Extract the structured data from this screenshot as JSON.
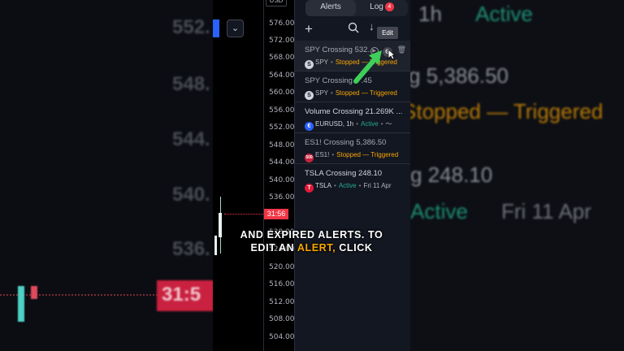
{
  "background_left": {
    "numbers": [
      "552.",
      "548.",
      "544.",
      "540.",
      "536."
    ],
    "price_box": "31:5"
  },
  "background_right": {
    "line1": "1h",
    "line1_status": "Active",
    "line2": "g 5,386.50",
    "line3": "Stopped — Triggered",
    "line4": "g 248.10",
    "line5_status": "Active",
    "line5_date": "Fri 11 Apr"
  },
  "axis": {
    "currency": "USD",
    "ticks": [
      "576.00",
      "572.00",
      "568.00",
      "564.00",
      "560.00",
      "556.00",
      "552.00",
      "548.00",
      "544.00",
      "540.00",
      "536.00",
      "532.00",
      "528.00",
      "524.00",
      "520.00",
      "516.00",
      "512.00",
      "508.00",
      "504.00"
    ],
    "price_tag": "31:56"
  },
  "panel": {
    "tabs": {
      "alerts": "Alerts",
      "log": "Log",
      "log_count": "4"
    },
    "tooltip": "Edit",
    "alerts": [
      {
        "title": "SPY Crossing 532.",
        "symbol": "SPY",
        "symbol_icon": "S",
        "status": "Stopped — Triggered",
        "status_kind": "stopped",
        "selected": true
      },
      {
        "title": "SPY Crossing 5 .45",
        "symbol": "SPY",
        "symbol_icon": "S",
        "status": "Stopped — Triggered",
        "status_kind": "stopped",
        "selected": false
      },
      {
        "title": "Volume Crossing 21.269K ...",
        "symbol": "EURUSD, 1h",
        "symbol_icon": "€",
        "status": "Active",
        "status_kind": "active",
        "selected": false
      },
      {
        "title": "ES1! Crossing 5,386.50",
        "symbol": "ES1!",
        "symbol_icon": "500",
        "status": "Stopped — Triggered",
        "status_kind": "stopped",
        "selected": false
      },
      {
        "title": "TSLA Crossing 248.10",
        "symbol": "TSLA",
        "symbol_icon": "T",
        "status": "Active",
        "status_kind": "active",
        "date": "Fri 11 Apr",
        "selected": false
      }
    ]
  },
  "caption": {
    "line1": "AND EXPIRED ALERTS. TO",
    "line2_a": "EDIT AN ",
    "line2_highlight": "ALERT,",
    "line2_b": " CLICK"
  },
  "colors": {
    "stopped": "#f7a600",
    "active": "#22ab94",
    "accent": "#2962ff",
    "arrow": "#3ecf5a"
  }
}
